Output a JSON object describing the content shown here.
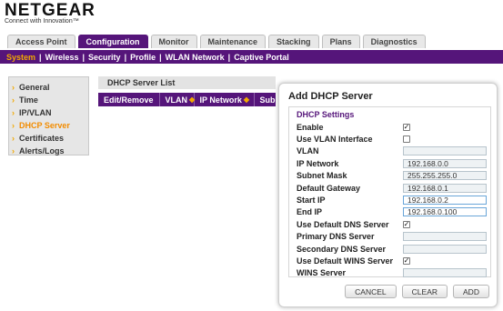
{
  "brand": {
    "name": "NETGEAR",
    "tagline": "Connect with Innovation™"
  },
  "top_tabs": [
    "Access Point",
    "Configuration",
    "Monitor",
    "Maintenance",
    "Stacking",
    "Plans",
    "Diagnostics"
  ],
  "top_tab_active": "Configuration",
  "subnav": [
    "System",
    "Wireless",
    "Security",
    "Profile",
    "WLAN Network",
    "Captive Portal"
  ],
  "subnav_active": "System",
  "left_menu": [
    "General",
    "Time",
    "IP/VLAN",
    "DHCP Server",
    "Certificates",
    "Alerts/Logs"
  ],
  "left_menu_active": "DHCP Server",
  "list": {
    "title": "DHCP Server List",
    "columns": [
      "Edit/Remove",
      "VLAN",
      "IP Network",
      "Sub"
    ]
  },
  "dialog": {
    "title": "Add DHCP Server",
    "section": "DHCP Settings",
    "fields": {
      "enable": {
        "label": "Enable",
        "checked": true
      },
      "use_vlan_interface": {
        "label": "Use VLAN Interface",
        "checked": false
      },
      "vlan": {
        "label": "VLAN",
        "value": ""
      },
      "ip_network": {
        "label": "IP Network",
        "value": "192.168.0.0"
      },
      "subnet_mask": {
        "label": "Subnet Mask",
        "value": "255.255.255.0"
      },
      "default_gateway": {
        "label": "Default Gateway",
        "value": "192.168.0.1"
      },
      "start_ip": {
        "label": "Start IP",
        "value": "192.168.0.2"
      },
      "end_ip": {
        "label": "End IP",
        "value": "192.168.0.100"
      },
      "use_default_dns": {
        "label": "Use Default DNS Server",
        "checked": true
      },
      "primary_dns": {
        "label": "Primary DNS Server",
        "value": ""
      },
      "secondary_dns": {
        "label": "Secondary DNS Server",
        "value": ""
      },
      "use_default_wins": {
        "label": "Use Default WINS Server",
        "checked": true
      },
      "wins_server": {
        "label": "WINS Server",
        "value": ""
      }
    },
    "buttons": {
      "cancel": "CANCEL",
      "clear": "CLEAR",
      "add": "ADD"
    }
  },
  "colors": {
    "brand_purple": "#55157a",
    "accent_orange": "#f2a900",
    "active_orange": "#f28c00"
  }
}
